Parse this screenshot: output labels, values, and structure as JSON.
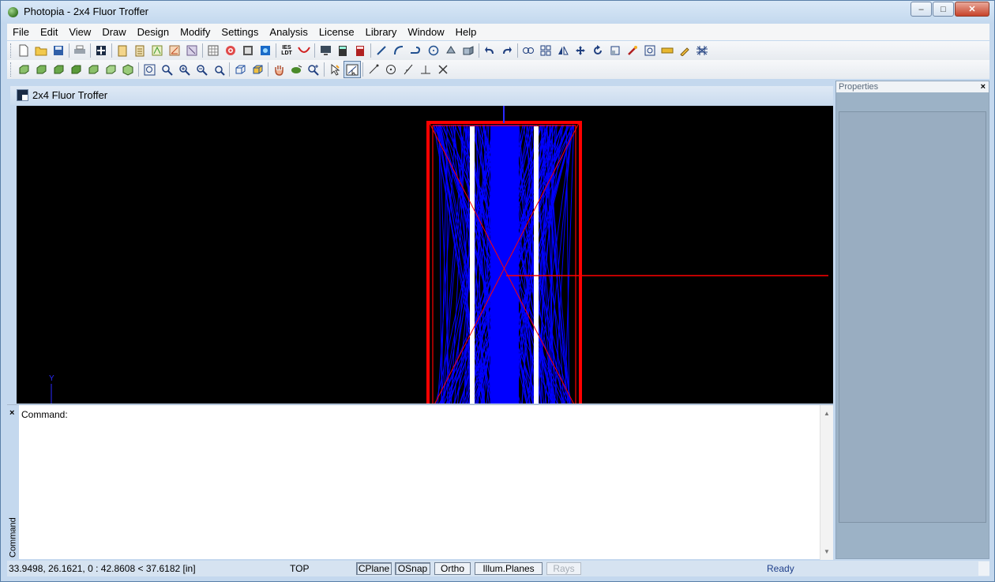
{
  "window": {
    "title": "Photopia - 2x4 Fluor Troffer",
    "minimize_label": "–",
    "maximize_label": "□",
    "close_label": "✕"
  },
  "menu": [
    "File",
    "Edit",
    "View",
    "Draw",
    "Design",
    "Modify",
    "Settings",
    "Analysis",
    "License",
    "Library",
    "Window",
    "Help"
  ],
  "toolbar1": {
    "icons": [
      "new-file-icon",
      "open-folder-icon",
      "save-icon",
      "print-icon",
      "layers-icon",
      "report-icon",
      "notes-icon",
      "photometric-icon",
      "angle-icon",
      "material-icon",
      "grid-icon",
      "target-icon",
      "shade-icon",
      "render-icon",
      "ies-ldt-icon",
      "curve-icon",
      "monitor-icon",
      "calculator-icon",
      "calculator-red-icon",
      "line-icon",
      "arc-icon",
      "polyline-icon",
      "circle-icon",
      "rotate-3d-icon",
      "extrude-icon",
      "undo-icon",
      "redo-icon",
      "link-icon",
      "array-icon",
      "mirror-icon",
      "move-icon",
      "rotate-icon",
      "scale-icon",
      "wand-icon",
      "focus-icon",
      "ruler-icon",
      "edit-icon",
      "mesh-icon"
    ],
    "ies_label": "IES LDT"
  },
  "toolbar2": {
    "icons": [
      "view-iso-1-icon",
      "view-iso-2-icon",
      "view-iso-3-icon",
      "view-iso-4-icon",
      "view-iso-5-icon",
      "view-iso-6-icon",
      "view-iso-7-icon",
      "zoom-extents-icon",
      "zoom-window-icon",
      "zoom-in-icon",
      "zoom-out-icon",
      "zoom-previous-icon",
      "cube-wire-icon",
      "cube-solid-icon",
      "pan-hand-icon",
      "orbit-icon",
      "zoom-realtime-icon",
      "select-pointer-icon",
      "select-window-icon",
      "snap-end-icon",
      "snap-center-icon",
      "snap-tangent-icon",
      "snap-perpendicular-icon",
      "snap-intersection-icon"
    ],
    "active_icon": "select-window-icon"
  },
  "document": {
    "title": "2x4 Fluor Troffer"
  },
  "viewport": {
    "background": "#000000",
    "y_axis_label": "Y",
    "colors": {
      "frame": "#ff0000",
      "rays": "#0000ff",
      "lamp": "#ffffff"
    }
  },
  "properties": {
    "title": "Properties",
    "close_label": "×"
  },
  "command": {
    "close_label": "×",
    "prompt": "Command:",
    "side_label": "Command"
  },
  "status": {
    "coords": "33.9498, 26.1621, 0 : 42.8608 < 37.6182 [in]",
    "view": "TOP",
    "buttons": [
      {
        "label": "CPlane",
        "state": "on"
      },
      {
        "label": "OSnap",
        "state": "on"
      },
      {
        "label": "Ortho",
        "state": "off"
      },
      {
        "label": "Illum.Planes",
        "state": "off"
      },
      {
        "label": "Rays",
        "state": "disabled"
      }
    ],
    "ready": "Ready"
  }
}
